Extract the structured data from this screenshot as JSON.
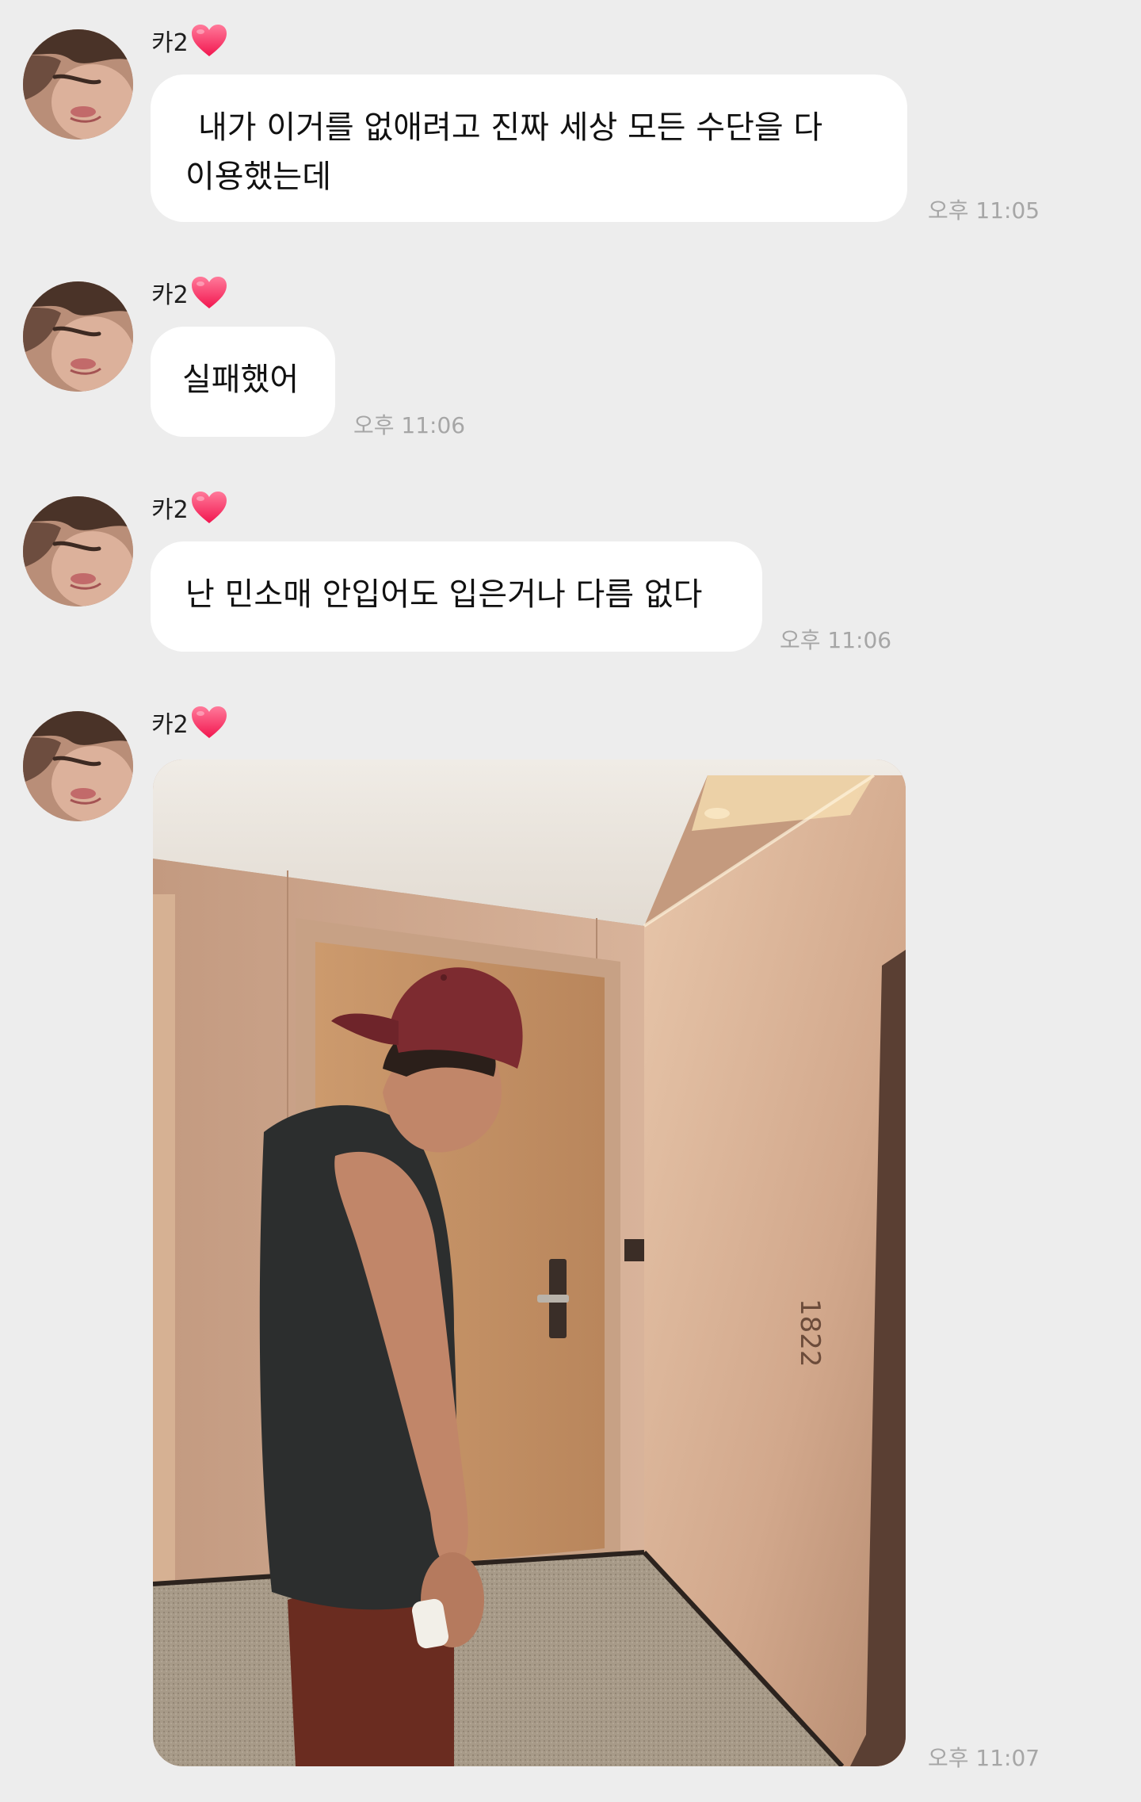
{
  "messages": [
    {
      "sender": "카2",
      "text": "내가 이거를 없애려고 진짜 세상 모든 수단을 다 이용했는데",
      "time": "오후 11:05"
    },
    {
      "sender": "카2",
      "text": "실패했어",
      "time": "오후 11:06"
    },
    {
      "sender": "카2",
      "text": "난 민소매 안입어도 입은거나 다름 없다",
      "time": "오후 11:06"
    },
    {
      "sender": "카2",
      "image": {
        "door_number": "1822"
      },
      "time": "오후 11:07"
    }
  ],
  "colors": {
    "background": "#ededed",
    "bubble": "#ffffff",
    "time_text": "#a6a6a6",
    "heart": "#ff3d6e"
  },
  "icons": {
    "sender_badge": "heart-icon"
  }
}
